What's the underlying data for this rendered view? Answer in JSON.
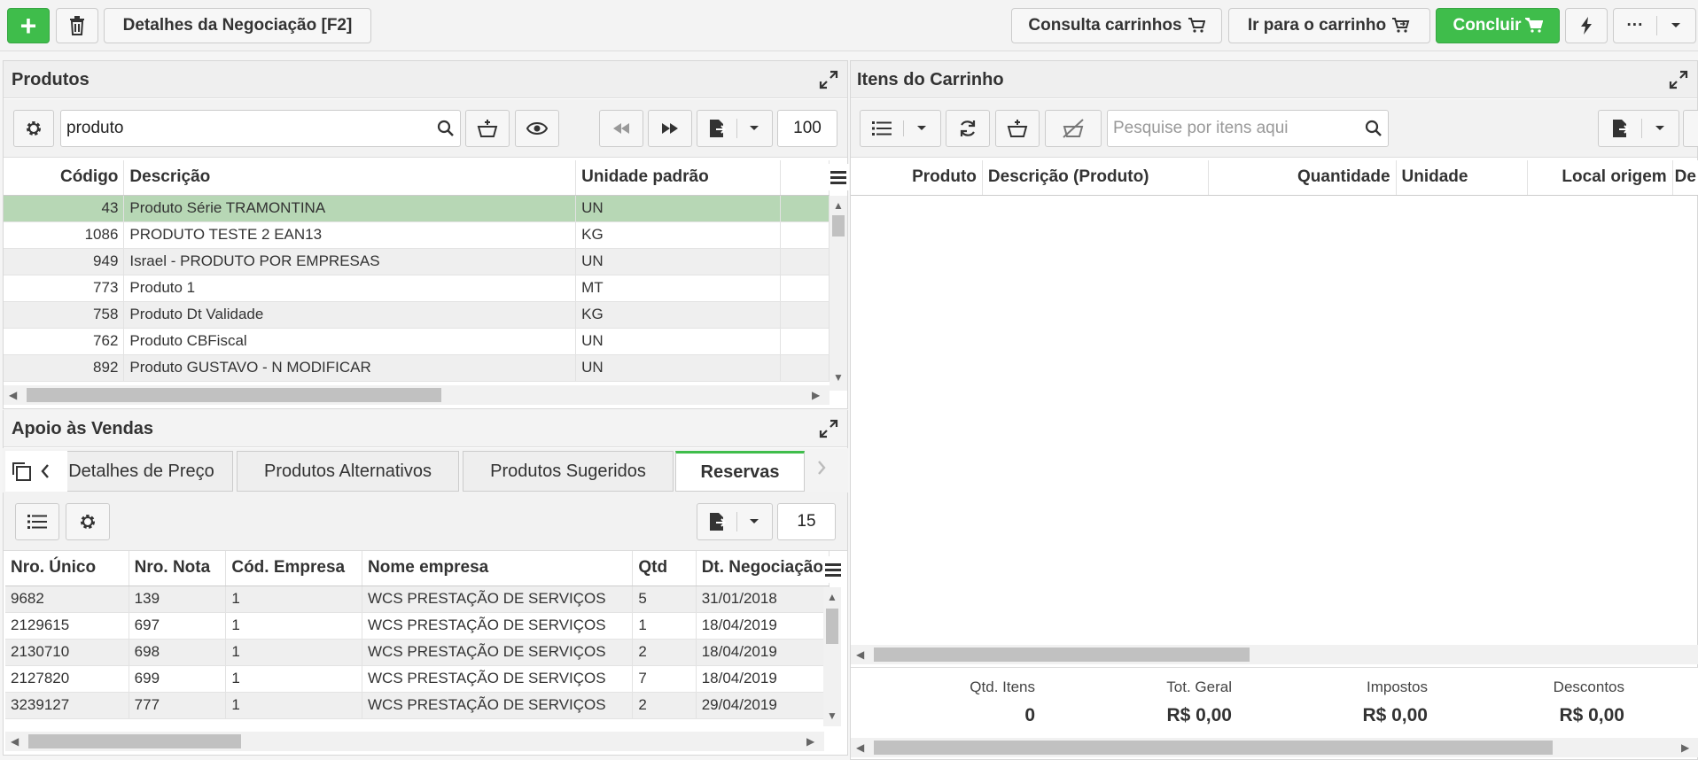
{
  "toolbar": {
    "add_label": "+",
    "details_label": "Detalhes da Negociação [F2]",
    "consulta_label": "Consulta carrinhos",
    "ir_carrinho_label": "Ir para o carrinho",
    "concluir_label": "Concluir",
    "more_label": "···"
  },
  "produtos": {
    "title": "Produtos",
    "search_value": "produto",
    "page_size": "100",
    "columns": [
      "Código",
      "Descrição",
      "Unidade padrão"
    ],
    "rows": [
      {
        "codigo": "43",
        "descricao": "Produto Série TRAMONTINA",
        "unidade": "UN"
      },
      {
        "codigo": "1086",
        "descricao": "PRODUTO TESTE 2 EAN13",
        "unidade": "KG"
      },
      {
        "codigo": "949",
        "descricao": "Israel - PRODUTO POR EMPRESAS",
        "unidade": "UN"
      },
      {
        "codigo": "773",
        "descricao": "Produto 1",
        "unidade": "MT"
      },
      {
        "codigo": "758",
        "descricao": "Produto Dt Validade",
        "unidade": "KG"
      },
      {
        "codigo": "762",
        "descricao": "Produto CBFiscal",
        "unidade": "UN"
      },
      {
        "codigo": "892",
        "descricao": "Produto GUSTAVO - N MODIFICAR",
        "unidade": "UN"
      }
    ]
  },
  "carrinho": {
    "title": "Itens do Carrinho",
    "search_placeholder": "Pesquise por itens aqui",
    "columns": [
      "Produto",
      "Descrição (Produto)",
      "Quantidade",
      "Unidade",
      "Local origem",
      "De"
    ],
    "totals": [
      {
        "label": "Qtd. Itens",
        "value": "0"
      },
      {
        "label": "Tot. Geral",
        "value": "R$ 0,00"
      },
      {
        "label": "Impostos",
        "value": "R$ 0,00"
      },
      {
        "label": "Descontos",
        "value": "R$ 0,00"
      }
    ]
  },
  "apoio": {
    "title": "Apoio às Vendas",
    "tabs": [
      "Detalhes de Preço",
      "Produtos Alternativos",
      "Produtos Sugeridos",
      "Reservas"
    ],
    "active_tab": "Reservas",
    "page_size": "15",
    "columns": [
      "Nro. Único",
      "Nro. Nota",
      "Cód. Empresa",
      "Nome empresa",
      "Qtd",
      "Dt. Negociação"
    ],
    "rows": [
      {
        "unico": "9682",
        "nota": "139",
        "empresa": "1",
        "nome": "WCS PRESTAÇÃO DE SERVIÇOS",
        "qtd": "5",
        "data": "31/01/2018"
      },
      {
        "unico": "2129615",
        "nota": "697",
        "empresa": "1",
        "nome": "WCS PRESTAÇÃO DE SERVIÇOS",
        "qtd": "1",
        "data": "18/04/2019"
      },
      {
        "unico": "2130710",
        "nota": "698",
        "empresa": "1",
        "nome": "WCS PRESTAÇÃO DE SERVIÇOS",
        "qtd": "2",
        "data": "18/04/2019"
      },
      {
        "unico": "2127820",
        "nota": "699",
        "empresa": "1",
        "nome": "WCS PRESTAÇÃO DE SERVIÇOS",
        "qtd": "7",
        "data": "18/04/2019"
      },
      {
        "unico": "3239127",
        "nota": "777",
        "empresa": "1",
        "nome": "WCS PRESTAÇÃO DE SERVIÇOS",
        "qtd": "2",
        "data": "29/04/2019"
      }
    ]
  },
  "colors": {
    "accent_green": "#3fbd4b",
    "selected_row": "#b7d7b5"
  }
}
